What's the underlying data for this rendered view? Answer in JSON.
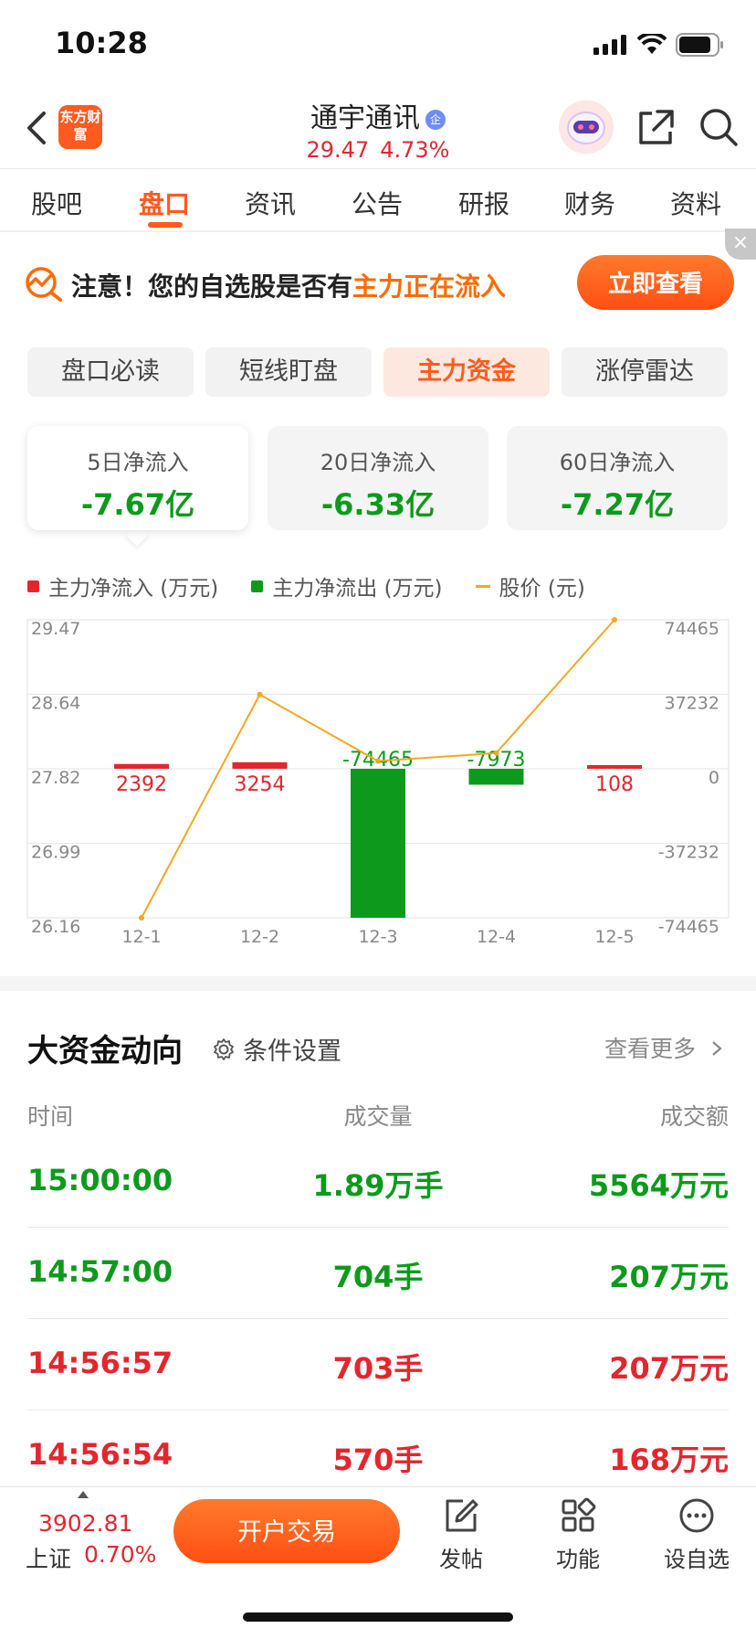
{
  "status_bar": {
    "time": "10:28"
  },
  "header": {
    "logo": "东方财富",
    "stock_name": "通宇通讯",
    "badge": "企",
    "price": "29.47",
    "change_pct": "4.73%"
  },
  "tabs": [
    "股吧",
    "盘口",
    "资讯",
    "公告",
    "研报",
    "财务",
    "资料"
  ],
  "active_tab": "盘口",
  "notice": {
    "text": "注意！您的自选股是否有",
    "highlight": "主力正在流入",
    "button": "立即查看",
    "close": "×"
  },
  "segments": [
    "盘口必读",
    "短线盯盘",
    "主力资金",
    "涨停雷达"
  ],
  "active_segment": "主力资金",
  "flow_cards": [
    {
      "label": "5日净流入",
      "value": "-7.67亿"
    },
    {
      "label": "20日净流入",
      "value": "-6.33亿"
    },
    {
      "label": "60日净流入",
      "value": "-7.27亿"
    }
  ],
  "legend": {
    "inflow": "主力净流入 (万元)",
    "outflow": "主力净流出 (万元)",
    "price": "股价 (元)"
  },
  "chart_data": {
    "type": "bar",
    "categories": [
      "12-1",
      "12-2",
      "12-3",
      "12-4",
      "12-5"
    ],
    "series": [
      {
        "name": "主力净流入 (万元)",
        "values": [
          2392,
          3254,
          -74465,
          -7973,
          108
        ]
      },
      {
        "name": "股价 (元)",
        "values": [
          26.16,
          28.64,
          27.9,
          27.99,
          29.47
        ]
      }
    ],
    "bar_labels": [
      "2392",
      "3254",
      "-74465",
      "-7973",
      "108"
    ],
    "left_axis_ticks": [
      "29.47",
      "28.64",
      "27.82",
      "26.99",
      "26.16"
    ],
    "right_axis_ticks": [
      "74465",
      "37232",
      "0",
      "-37232",
      "-74465"
    ],
    "left_range": [
      26.16,
      29.47
    ],
    "right_range": [
      -74465,
      74465
    ],
    "colors": {
      "inflow": "#e3262e",
      "outflow": "#0d9a1c",
      "price": "#f5a623"
    },
    "grid": true
  },
  "big_money": {
    "title": "大资金动向",
    "settings": "条件设置",
    "more": "查看更多",
    "columns": [
      "时间",
      "成交量",
      "成交额"
    ],
    "rows": [
      {
        "time": "15:00:00",
        "volume": "1.89万手",
        "amount": "5564万元",
        "dir": "green"
      },
      {
        "time": "14:57:00",
        "volume": "704手",
        "amount": "207万元",
        "dir": "green"
      },
      {
        "time": "14:56:57",
        "volume": "703手",
        "amount": "207万元",
        "dir": "red"
      },
      {
        "time": "14:56:54",
        "volume": "570手",
        "amount": "168万元",
        "dir": "red"
      }
    ]
  },
  "bottom_bar": {
    "index_value": "3902.81",
    "index_name": "上证",
    "index_pct": "0.70%",
    "trade_button": "开户交易",
    "items": [
      "发帖",
      "功能",
      "设自选"
    ]
  }
}
